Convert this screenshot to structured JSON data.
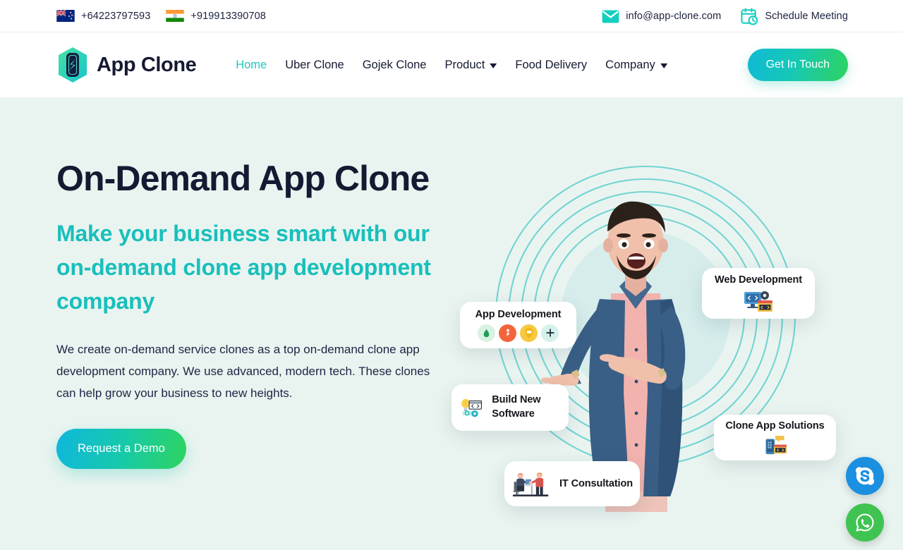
{
  "topbar": {
    "phones": [
      {
        "flag": "new-zealand-flag",
        "number": "+64223797593"
      },
      {
        "flag": "india-flag",
        "number": "+919913390708"
      }
    ],
    "email": {
      "icon": "envelope-icon",
      "text": "info@app-clone.com"
    },
    "meeting": {
      "icon": "calendar-clock-icon",
      "text": "Schedule Meeting"
    }
  },
  "header": {
    "logo": {
      "icon": "app-clone-hexagon-logo",
      "text": "App Clone"
    },
    "nav": [
      {
        "label": "Home",
        "active": true,
        "dropdown": false
      },
      {
        "label": "Uber Clone",
        "active": false,
        "dropdown": false
      },
      {
        "label": "Gojek Clone",
        "active": false,
        "dropdown": false
      },
      {
        "label": "Product",
        "active": false,
        "dropdown": true
      },
      {
        "label": "Food Delivery",
        "active": false,
        "dropdown": false
      },
      {
        "label": "Company",
        "active": false,
        "dropdown": true
      }
    ],
    "cta_label": "Get In Touch"
  },
  "hero": {
    "title": "On-Demand App Clone",
    "subtitle": "Make your business smart with our on-demand clone app development company",
    "description": "We create on-demand service clones as a top on-demand clone app development company. We use advanced, modern tech. These clones can help grow your business to new heights.",
    "demo_button": "Request a Demo",
    "cards": [
      {
        "label": "App Development",
        "icon": "app-icons-row"
      },
      {
        "label": "Web Development",
        "icon": "monitor-code-gear-icon"
      },
      {
        "label": "Build New Software",
        "icon": "lightbulb-code-gears-icon"
      },
      {
        "label": "Clone App Solutions",
        "icon": "phone-code-window-icon"
      },
      {
        "label": "IT Consultation",
        "icon": "consultation-people-icon"
      }
    ],
    "person_alt": "man-pointing-illustration"
  },
  "social": [
    {
      "name": "skype",
      "color": "#1b8fe0"
    },
    {
      "name": "whatsapp",
      "color": "#3fc351"
    }
  ],
  "colors": {
    "accent_teal": "#19bfbb",
    "navy": "#151a33",
    "hero_bg": "#e9f4f0",
    "gradient_start": "#0fb7dd",
    "gradient_end": "#2ed45f"
  }
}
